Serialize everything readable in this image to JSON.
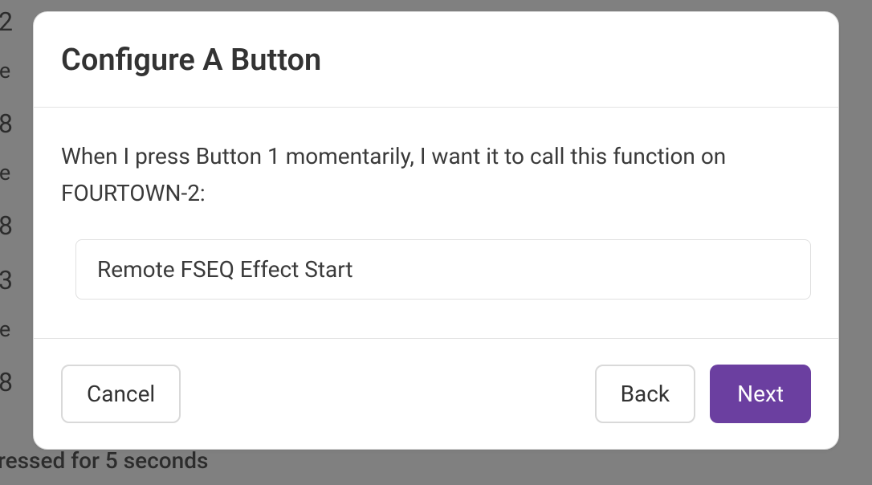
{
  "background": {
    "lines": [
      "2",
      "re",
      "8",
      "re",
      "8",
      "3",
      "re",
      "8"
    ],
    "bottom_text": "ressed for 5 seconds"
  },
  "modal": {
    "title": "Configure A Button",
    "prompt": "When I press Button 1 momentarily, I want it to call this function on FOURTOWN-2:",
    "select_value": "Remote FSEQ Effect Start",
    "buttons": {
      "cancel": "Cancel",
      "back": "Back",
      "next": "Next"
    }
  }
}
